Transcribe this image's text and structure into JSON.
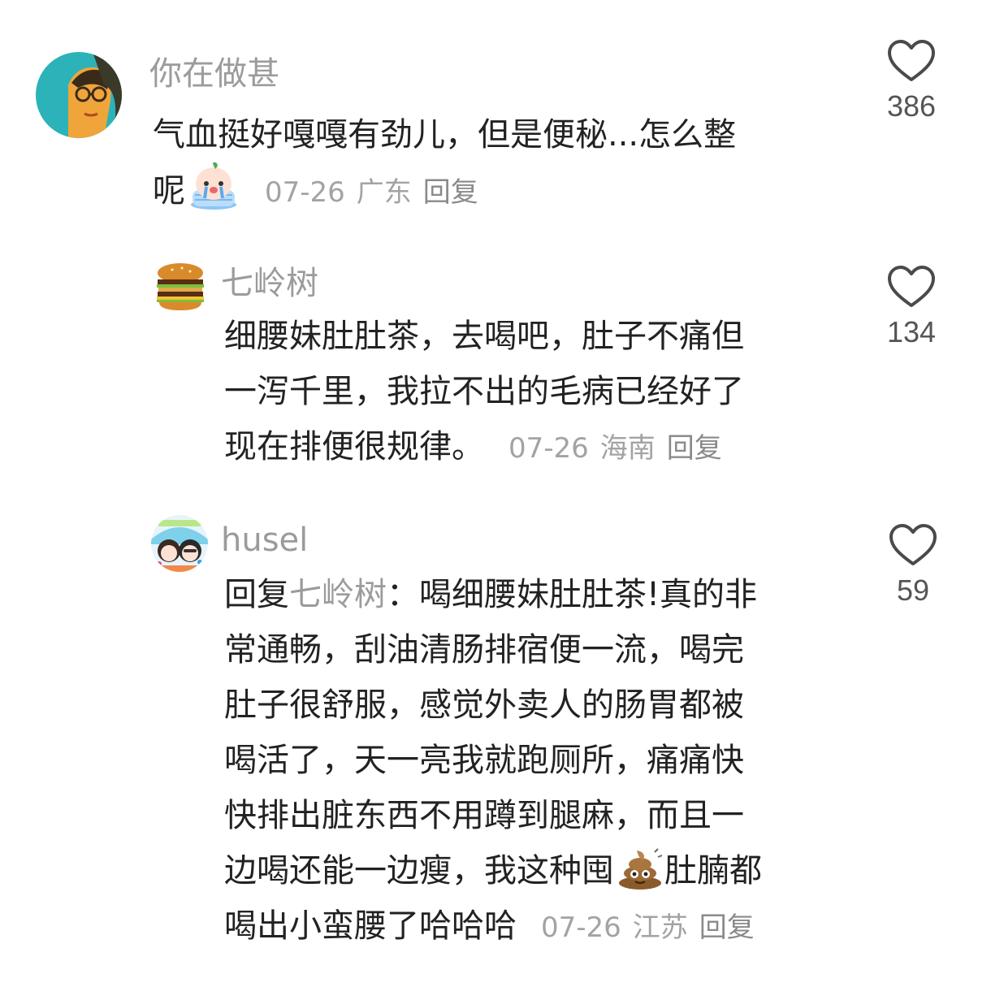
{
  "comments": [
    {
      "username": "你在做甚",
      "lines": [
        "气血挺好嘎嘎有劲儿，但是便秘...怎么整",
        "呢"
      ],
      "emoji": "crying-face-emoji",
      "date": "07-26",
      "region": "广东",
      "reply_label": "回复",
      "likes": "386"
    },
    {
      "username": "七岭树",
      "lines": [
        "细腰妹肚肚茶，去喝吧，肚子不痛但",
        "一泻千里，我拉不出的毛病已经好了",
        "现在排便很规律。"
      ],
      "date": "07-26",
      "region": "海南",
      "reply_label": "回复",
      "likes": "134"
    },
    {
      "username": "husel",
      "reply_prefix": "回复",
      "reply_to": "七岭树",
      "reply_colon": "：",
      "line1_rest": "喝细腰妹肚肚茶!真的非",
      "lines": [
        "常通畅，刮油清肠排宿便一流，喝完",
        "肚子很舒服，感觉外卖人的肠胃都被",
        "喝活了，天一亮我就跑厕所，痛痛快",
        "快排出脏东西不用蹲到腿麻，而且一"
      ],
      "line7_start": "边喝还能一边瘦，我这种囤",
      "line7_end": "肚腩都",
      "line8": "喝出小蛮腰了哈哈哈",
      "emoji": "poop-emoji",
      "date": "07-26",
      "region": "江苏",
      "reply_label": "回复",
      "likes": "59"
    }
  ],
  "icons": {
    "like": "heart-outline-icon"
  },
  "colors": {
    "username": "#9b9b9b",
    "meta": "#a3a3a3",
    "text": "#222222"
  }
}
